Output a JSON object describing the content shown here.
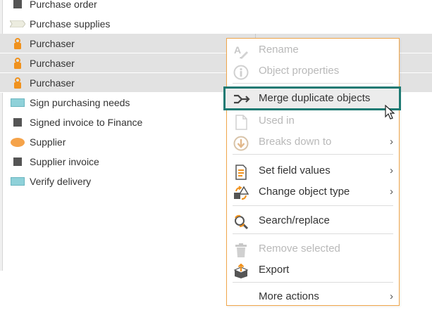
{
  "list": {
    "items": [
      {
        "label": "Purchase order",
        "icon": "dark-square-icon",
        "selected": false
      },
      {
        "label": "Purchase supplies",
        "icon": "flag-shape-icon",
        "selected": false
      },
      {
        "label": "Purchaser",
        "icon": "person-icon",
        "selected": true
      },
      {
        "label": "Purchaser",
        "icon": "person-icon",
        "selected": true
      },
      {
        "label": "Purchaser",
        "icon": "person-icon",
        "selected": true
      },
      {
        "label": "Sign purchasing needs",
        "icon": "cyan-rectangle-icon",
        "selected": false
      },
      {
        "label": "Signed invoice to Finance",
        "icon": "dark-square-icon",
        "selected": false
      },
      {
        "label": "Supplier",
        "icon": "orange-oval-icon",
        "selected": false
      },
      {
        "label": "Supplier invoice",
        "icon": "dark-square-icon",
        "selected": false
      },
      {
        "label": "Verify delivery",
        "icon": "cyan-rectangle-icon",
        "selected": false
      }
    ]
  },
  "context_menu": {
    "items": [
      {
        "label": "Rename",
        "icon": "rename-icon",
        "enabled": false,
        "submenu": false
      },
      {
        "label": "Object properties",
        "icon": "info-icon",
        "enabled": false,
        "submenu": false
      },
      {
        "label": "Merge duplicate objects",
        "icon": "merge-icon",
        "enabled": true,
        "submenu": false,
        "highlighted": true
      },
      {
        "label": "Used in",
        "icon": "document-icon",
        "enabled": false,
        "submenu": false
      },
      {
        "label": "Breaks down to",
        "icon": "breakdown-icon",
        "enabled": false,
        "submenu": true
      },
      {
        "label": "Set field values",
        "icon": "field-values-icon",
        "enabled": true,
        "submenu": true
      },
      {
        "label": "Change object type",
        "icon": "change-type-icon",
        "enabled": true,
        "submenu": true
      },
      {
        "label": "Search/replace",
        "icon": "search-replace-icon",
        "enabled": true,
        "submenu": false
      },
      {
        "label": "Remove selected",
        "icon": "trash-icon",
        "enabled": false,
        "submenu": false
      },
      {
        "label": "Export",
        "icon": "export-icon",
        "enabled": true,
        "submenu": false
      },
      {
        "label": "More actions",
        "icon": "",
        "enabled": true,
        "submenu": true
      }
    ],
    "submenu_arrow": "›"
  },
  "colors": {
    "selection": "#e2e2e2",
    "menu_border": "#f0a64b",
    "highlight_border": "#1e7a73",
    "person_icon": "#f0921e",
    "cyan_shape": "#8fd1d9",
    "orange_shape": "#f5a34a"
  }
}
